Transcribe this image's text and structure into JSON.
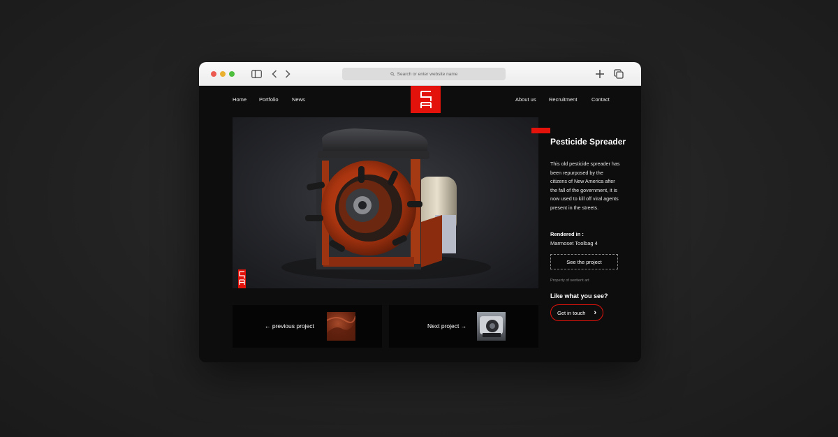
{
  "browser": {
    "url_placeholder": "Search or enter website name"
  },
  "nav": {
    "left": [
      "Home",
      "Portfolio",
      "News"
    ],
    "right": [
      "About us",
      "Recruitment",
      "Contact"
    ]
  },
  "project": {
    "title": "Pesticide Spreader",
    "description": "This old pesticide spreader has been repurposed by the citizens of New America after the fall of the government, it is now used to kill off viral agents present in the streets.",
    "rendered_label": "Rendered in :",
    "rendered_value": "Marmoset Toolbag 4",
    "see_button": "See the project",
    "property_note": "Property of sentient art"
  },
  "cta": {
    "heading": "Like what you see?",
    "button": "Get in touch"
  },
  "pager": {
    "previous": "← previous project",
    "next": "Next project →"
  },
  "colors": {
    "accent": "#e3120b",
    "background": "#0d0d0d"
  }
}
